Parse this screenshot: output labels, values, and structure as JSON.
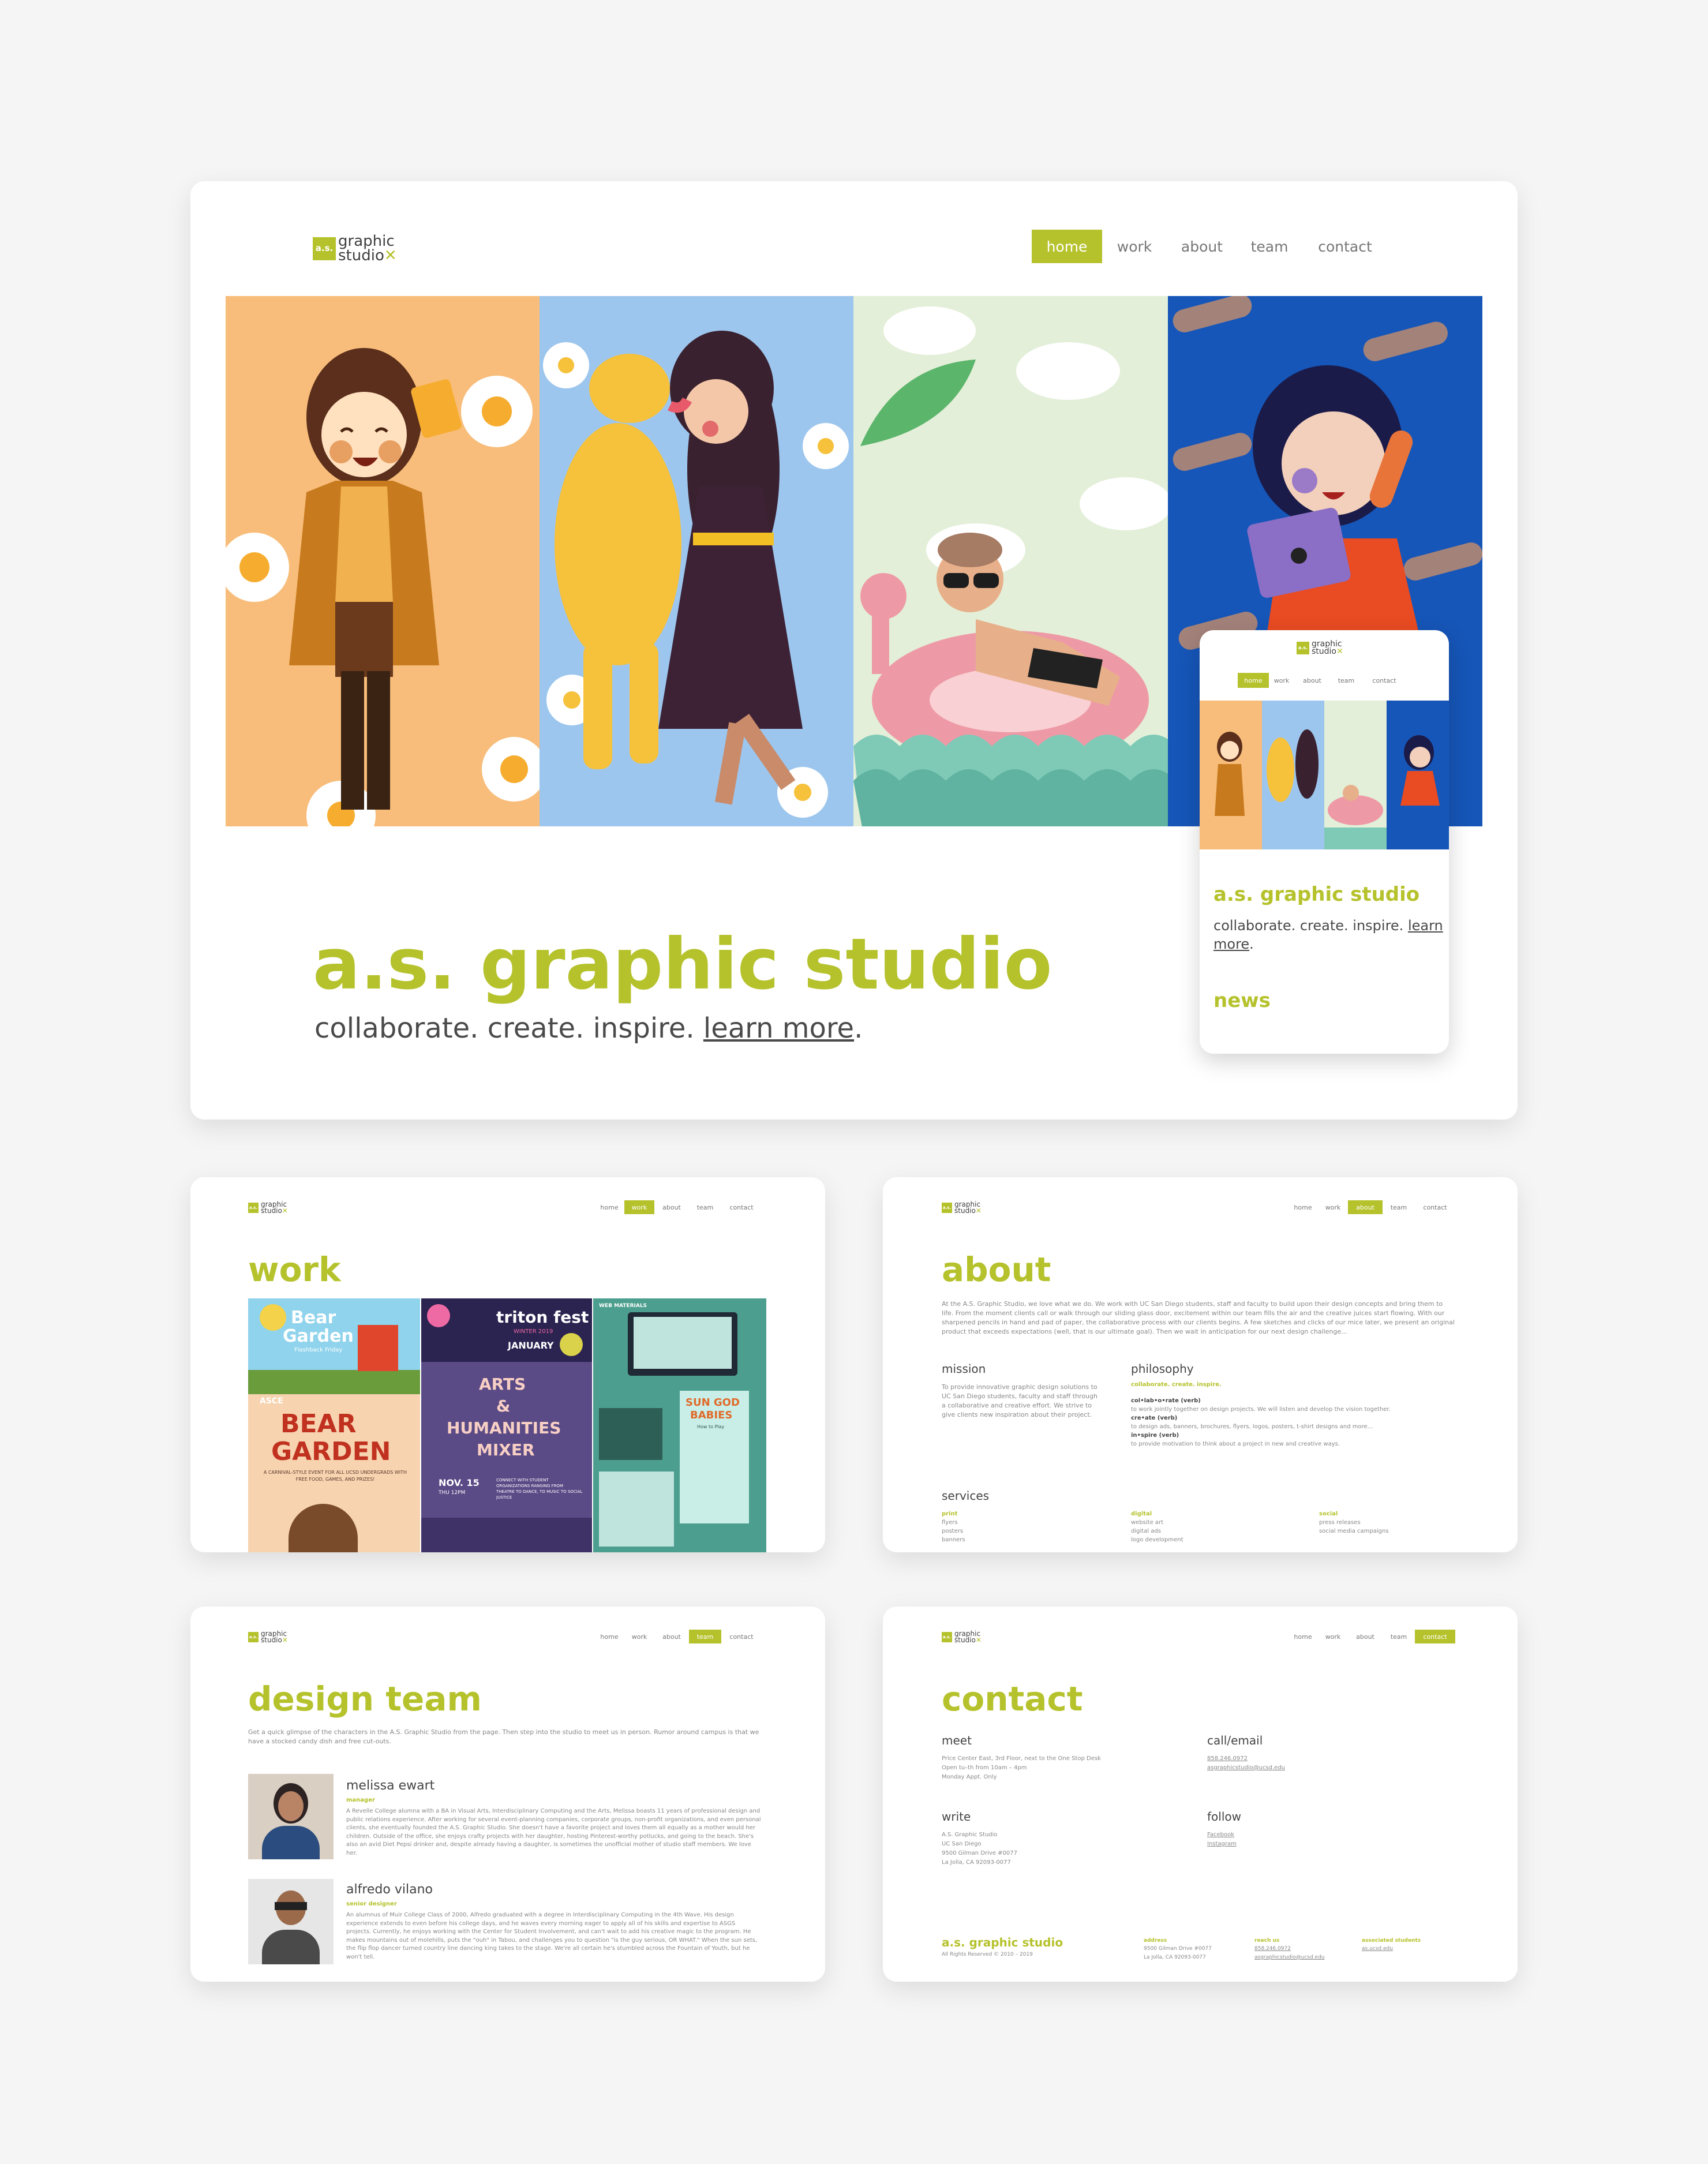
{
  "brand": {
    "logo_mark": "a.s.",
    "logo_line1": "graphic",
    "logo_line2": "studio",
    "logo_x": "✕"
  },
  "colors": {
    "accent": "#b5c22c",
    "background": "#f5f5f5",
    "card": "#ffffff"
  },
  "nav": [
    "home",
    "work",
    "about",
    "team",
    "contact"
  ],
  "hero": {
    "title": "a.s. graphic studio",
    "tagline": "collaborate. create. inspire.",
    "learn_more": "learn more",
    "period": "."
  },
  "mobile": {
    "title": "a.s. graphic studio",
    "tagline": "collaborate. create. inspire.",
    "learn": "learn",
    "more": "more",
    "period": ".",
    "news": "news"
  },
  "work": {
    "title": "work",
    "tiles": {
      "bear_small": {
        "line1": "Bear",
        "line2": "Garden",
        "line3": "Flashback Friday"
      },
      "bear_big": {
        "org": "ASCE",
        "line1": "BEAR",
        "line2": "GARDEN",
        "sub": "A CARNIVAL-STYLE EVENT FOR ALL UCSD UNDERGRADS WITH FREE FOOD, GAMES, AND PRIZES!"
      },
      "triton": {
        "title": "triton fest",
        "sub": "WINTER 2019",
        "date": "JANUARY"
      },
      "arts": {
        "l1": "ARTS",
        "l2": "&",
        "l3": "HUMANITIES",
        "l4": "MIXER",
        "date": "NOV. 15",
        "time": "THU 12PM",
        "desc": "CONNECT WITH STUDENT ORGANIZATIONS RANGING FROM THEATRE TO DANCE, TO MUSIC TO SOCIAL JUSTICE"
      },
      "web": {
        "label": "WEB MATERIALS",
        "title1": "SUN GOD",
        "title2": "BABIES",
        "sub": "How to Play"
      }
    }
  },
  "about": {
    "title": "about",
    "intro": "At the A.S. Graphic Studio, we love what we do. We work with UC San Diego students, staff and faculty to build upon their design concepts and bring them to life. From the moment clients call or walk through our sliding glass door, excitement within our team fills the air and the creative juices start flowing. With our sharpened pencils in hand and pad of paper, the collaborative process with our clients begins. A few sketches and clicks of our mice later, we present an original product that exceeds expectations (well, that is our ultimate goal). Then we wait in anticipation for our next design challenge...",
    "mission_h": "mission",
    "mission": "To provide innovative graphic design solutions to UC San Diego students, faculty and staff through a collaborative and creative effort. We strive to give clients new inspiration about their project.",
    "philosophy_h": "philosophy",
    "philosophy_tag": "collaborate. create. inspire.",
    "phil": [
      {
        "term": "col•lab•o•rate (verb)",
        "def": "to work jointly together on design projects. We will listen and develop the vision together."
      },
      {
        "term": "cre•ate (verb)",
        "def": "to design ads, banners, brochures, flyers, logos, posters, t-shirt designs and more..."
      },
      {
        "term": "in•spire (verb)",
        "def": "to provide motivation to think about a project in new and creative ways."
      }
    ],
    "services_h": "services",
    "services": [
      {
        "h": "print",
        "items": [
          "flyers",
          "posters",
          "banners"
        ]
      },
      {
        "h": "digital",
        "items": [
          "website art",
          "digital ads",
          "logo development"
        ]
      },
      {
        "h": "social",
        "items": [
          "press releases",
          "social media campaigns"
        ]
      }
    ]
  },
  "team": {
    "title": "design team",
    "intro": "Get a quick glimpse of the characters in the A.S. Graphic Studio from the page. Then step into the studio to meet us in person. Rumor around campus is that we have a stocked candy dish and free cut-outs.",
    "members": [
      {
        "name": "melissa ewart",
        "role": "manager",
        "bio": "A Revelle College alumna with a BA in Visual Arts, Interdisciplinary Computing and the Arts, Melissa boasts 11 years of professional design and public relations experience. After working for several event-planning companies, corporate groups, non-profit organizations, and even personal clients, she eventually founded the A.S. Graphic Studio. She doesn't have a favorite project and loves them all equally as a mother would her children. Outside of the office, she enjoys crafty projects with her daughter, hosting Pinterest-worthy potlucks, and going to the beach. She's also an avid Diet Pepsi drinker and, despite already having a daughter, is sometimes the unofficial mother of studio staff members. We love her."
      },
      {
        "name": "alfredo vilano",
        "role": "senior designer",
        "bio": "An alumnus of Muir College Class of 2000, Alfredo graduated with a degree in Interdisciplinary Computing in the 4th Wave. His design experience extends to even before his college days, and he waves every morning eager to apply all of his skills and expertise to ASGS projects. Currently, he enjoys working with the Center for Student Involvement, and can't wait to add his creative magic to the program. He makes mountains out of molehills, puts the \"ouh\" in Tabou, and challenges you to question \"is the guy serious, OR WHAT.\" When the sun sets, the flip flop dancer turned country line dancing king takes to the stage. We're all certain he's stumbled across the Fountain of Youth, but he won't tell."
      }
    ]
  },
  "contact": {
    "title": "contact",
    "meet_h": "meet",
    "meet": [
      "Price Center East, 3rd Floor, next to the One Stop Desk",
      "Open tu–th from 10am – 4pm",
      "Monday Appt. Only"
    ],
    "call_h": "call/email",
    "call": [
      "858.246.0972",
      "asgraphicstudio@ucsd.edu"
    ],
    "write_h": "write",
    "write": [
      "A.S. Graphic Studio",
      "UC San Diego",
      "9500 Gilman Drive #0077",
      "La Jolla, CA 92093-0077"
    ],
    "follow_h": "follow",
    "follow": [
      "Facebook",
      "Instagram"
    ],
    "footer": {
      "name": "a.s. graphic studio",
      "rights": "All Rights Reserved © 2010 – 2019",
      "address_h": "address",
      "address": [
        "9500 Gilman Drive #0077",
        "La Jolla, CA 92093-0077"
      ],
      "reach_h": "reach us",
      "reach": [
        "858.246.0972",
        "asgraphicstudio@ucsd.edu"
      ],
      "assoc_h": "associated students",
      "assoc": [
        "as.ucsd.edu"
      ]
    }
  }
}
